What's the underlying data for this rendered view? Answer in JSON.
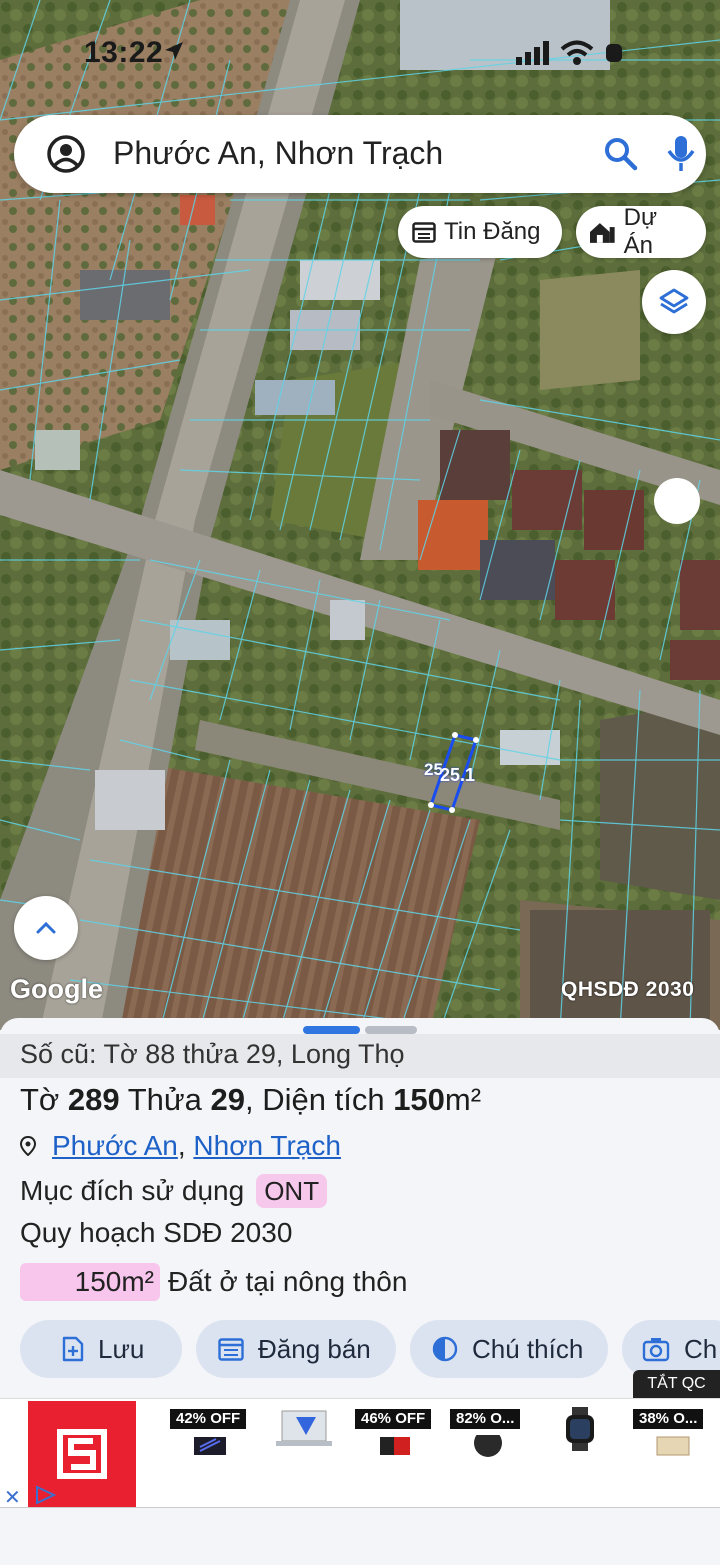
{
  "status": {
    "time": "13:22"
  },
  "search": {
    "query": "Phước An, Nhơn Trạch"
  },
  "chips": {
    "listing": "Tin Đăng",
    "project": "Dự Án"
  },
  "map": {
    "google_label": "Google",
    "plan_label": "QHSDĐ 2030",
    "parcel_label_a": "25",
    "parcel_label_b": "25.1"
  },
  "sheet": {
    "old_ref": "Số cũ: Tờ 88 thửa 29, Long Thọ",
    "sheet_word": "Tờ",
    "sheet_no": "289",
    "plot_word": "Thửa",
    "plot_no": "29",
    "area_word": "Diện tích",
    "area_value": "150",
    "area_unit": "m²",
    "ward": "Phước An",
    "district": "Nhơn Trạch",
    "purpose_label": "Mục đích sử dụng",
    "purpose_code": "ONT",
    "plan_label": "Quy hoạch SDĐ 2030",
    "plan_area": "150m²",
    "plan_type": "Đất ở tại nông thôn"
  },
  "actions": {
    "save": "Lưu",
    "post_sale": "Đăng bán",
    "legend": "Chú thích",
    "photo": "Ch"
  },
  "ad": {
    "hide_label": "TẮT QC",
    "deals": [
      "42% OFF",
      "46% OFF",
      "82% O...",
      "38% O..."
    ],
    "colors": {
      "brand": "#e8202f",
      "accent": "#2f76e0"
    }
  }
}
